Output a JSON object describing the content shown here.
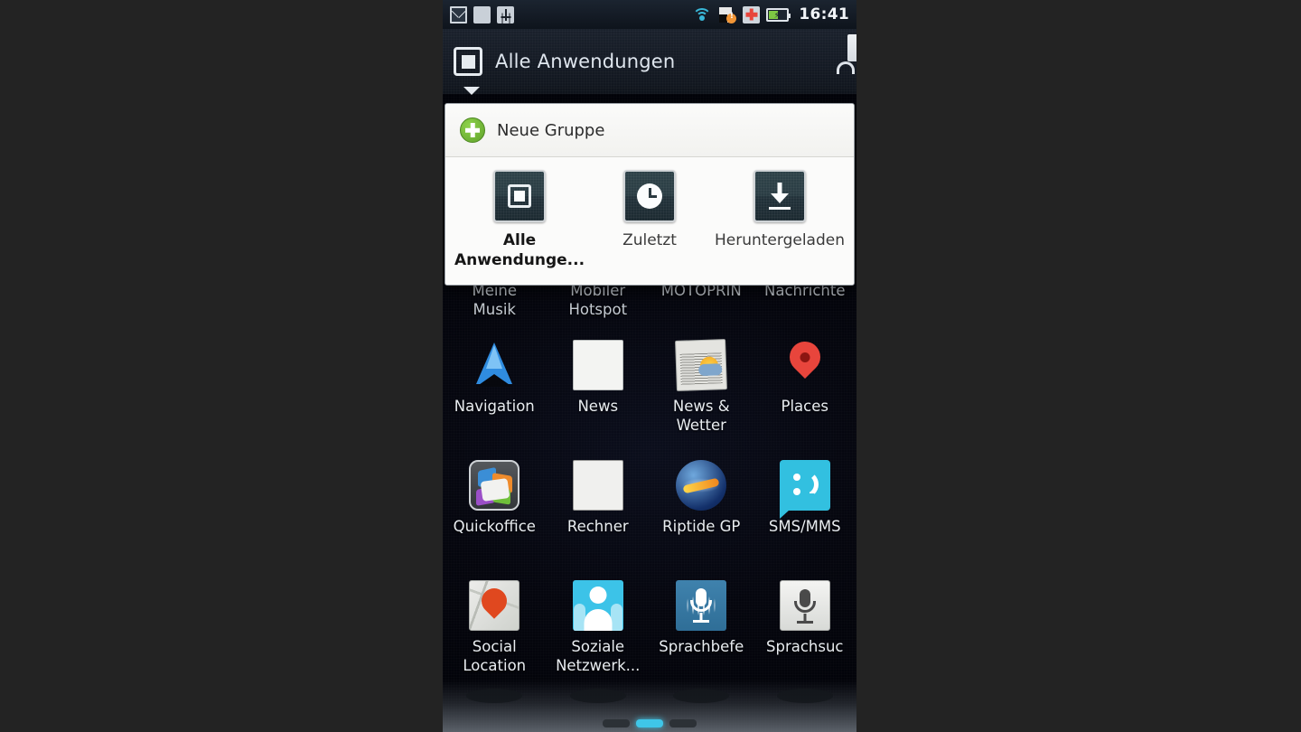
{
  "status_bar": {
    "time": "16:41",
    "left_icons": [
      {
        "name": "gmail-icon",
        "label": "Gmail"
      },
      {
        "name": "app-grid-icon",
        "label": "Apps"
      },
      {
        "name": "usb-debug-icon",
        "label": "USB-Debugging"
      }
    ],
    "right_icons": [
      {
        "name": "wifi-icon",
        "label": "WLAN"
      },
      {
        "name": "sd-card-warning-icon",
        "label": "SD-Karte"
      },
      {
        "name": "plus-red-icon",
        "label": "Hinzufügen"
      },
      {
        "name": "battery-charging-icon",
        "label": "Akku lädt"
      }
    ]
  },
  "action_bar": {
    "title": "Alle Anwendungen",
    "spinner_icon": "all-apps-icon",
    "caret_icon": "caret-down-icon",
    "market_icon": "market-bag-icon"
  },
  "popup": {
    "new_group": {
      "label": "Neue Gruppe",
      "icon": "plus-circle-icon"
    },
    "tiles": [
      {
        "label": "Alle\nAnwendunge...",
        "icon": "all-apps-icon",
        "active": true
      },
      {
        "label": "Zuletzt",
        "icon": "clock-icon",
        "active": false
      },
      {
        "label": "Heruntergeladen",
        "icon": "download-icon",
        "active": false
      }
    ]
  },
  "app_grid": {
    "clipped_row_labels": [
      "Meine\nMusik",
      "Mobiler\nHotspot",
      "MOTOPRIN",
      "Nachrichte"
    ],
    "rows": [
      [
        {
          "label": "Navigation",
          "icon": "navigation-icon"
        },
        {
          "label": "News",
          "icon": "news-icon"
        },
        {
          "label": "News &\nWetter",
          "icon": "news-and-weather-icon"
        },
        {
          "label": "Places",
          "icon": "places-icon"
        }
      ],
      [
        {
          "label": "Quickoffice",
          "icon": "quickoffice-icon"
        },
        {
          "label": "Rechner",
          "icon": "calculator-icon"
        },
        {
          "label": "Riptide GP",
          "icon": "riptide-gp-icon"
        },
        {
          "label": "SMS/MMS",
          "icon": "sms-mms-icon"
        }
      ],
      [
        {
          "label": "Social\nLocation",
          "icon": "social-location-icon"
        },
        {
          "label": "Soziale\nNetzwerk...",
          "icon": "social-networks-icon"
        },
        {
          "label": "Sprachbefe",
          "icon": "voice-command-icon"
        },
        {
          "label": "Sprachsuc",
          "icon": "voice-search-icon"
        }
      ]
    ]
  },
  "dock": {
    "page_indicator": {
      "total": 3,
      "active_index": 1
    }
  },
  "colors": {
    "accent_cyan": "#3fc6e8",
    "wallpaper_dark": "#05070f",
    "popup_bg": "#f7f7f5",
    "status_bar": "#141b25"
  }
}
